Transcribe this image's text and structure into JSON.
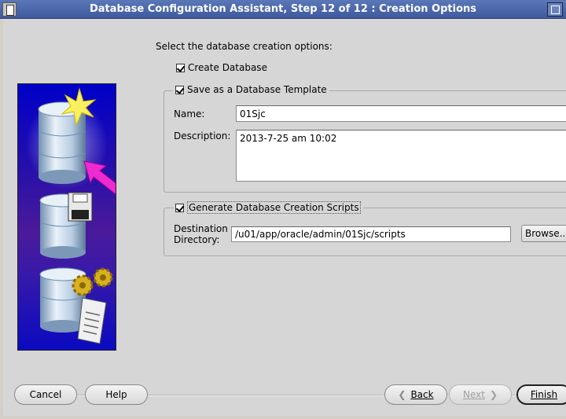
{
  "window": {
    "title": "Database Configuration Assistant, Step 12 of 12 : Creation Options"
  },
  "content": {
    "instruction": "Select the database creation options:",
    "create_database": {
      "label": "Create Database",
      "checked": true
    },
    "save_template": {
      "label": "Save as a Database Template",
      "checked": true,
      "name_label": "Name:",
      "name_value": "01Sjc",
      "description_label": "Description:",
      "description_value": "2013-7-25 am 10:02"
    },
    "generate_scripts": {
      "label": "Generate Database Creation Scripts",
      "checked": true,
      "dest_label_line1": "Destination",
      "dest_label_line2": "Directory:",
      "dest_value": "/u01/app/oracle/admin/01Sjc/scripts",
      "browse_label": "Browse..."
    }
  },
  "buttons": {
    "cancel": "Cancel",
    "help": "Help",
    "back": "Back",
    "next": "Next",
    "finish": "Finish"
  }
}
